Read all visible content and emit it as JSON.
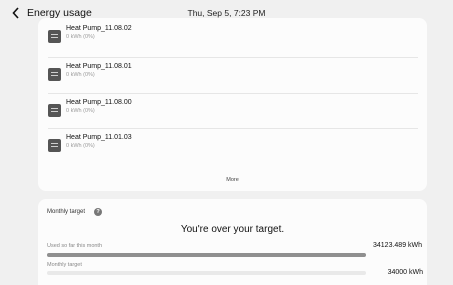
{
  "header": {
    "title": "Energy usage",
    "datetime": "Thu, Sep 5, 7:23 PM"
  },
  "devices": [
    {
      "name": "Heat Pump_11.08.02",
      "usage": "0 kWh (0%)"
    },
    {
      "name": "Heat Pump_11.08.01",
      "usage": "0 kWh (0%)"
    },
    {
      "name": "Heat Pump_11.08.00",
      "usage": "0 kWh (0%)"
    },
    {
      "name": "Heat Pump_11.01.03",
      "usage": "0 kWh (0%)"
    }
  ],
  "more_label": "More",
  "monthly_target": {
    "label": "Monthly target",
    "message": "You're over your target.",
    "used_label": "Used so far this month",
    "used_value": "34123.489 kWh",
    "used_fraction": 1.0,
    "target_label": "Monthly target",
    "target_value": "34000 kWh",
    "target_fraction": 0.0
  },
  "colors": {
    "background": "#f0f0f0",
    "card": "#fcfcfc",
    "bar_fill": "#8f8f8f",
    "bar_track": "#e9e9e9"
  },
  "icons": [
    "back-chevron-icon",
    "device-icon",
    "help-icon"
  ]
}
